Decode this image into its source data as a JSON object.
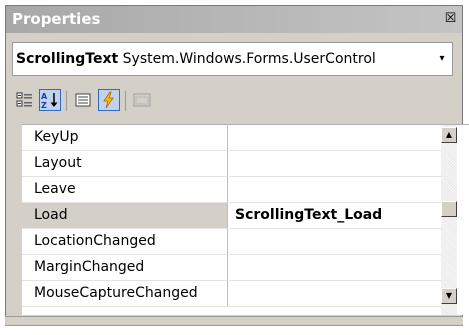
{
  "window": {
    "title": "Properties",
    "close_symbol": "☒"
  },
  "object_selector": {
    "object_name": "ScrollingText",
    "object_type": "System.Windows.Forms.UserControl",
    "dropdown_symbol": "▾"
  },
  "toolbar": {
    "buttons": [
      {
        "icon": "categorized-icon",
        "pressed": false
      },
      {
        "icon": "alphabetical-sort-icon",
        "pressed": true
      },
      {
        "icon": "properties-icon",
        "pressed": false
      },
      {
        "icon": "events-lightning-icon",
        "pressed": true
      },
      {
        "icon": "property-pages-icon",
        "pressed": false
      }
    ]
  },
  "grid": {
    "rows": [
      {
        "name": "KeyUp",
        "value": ""
      },
      {
        "name": "Layout",
        "value": ""
      },
      {
        "name": "Leave",
        "value": ""
      },
      {
        "name": "Load",
        "value": "ScrollingText_Load"
      },
      {
        "name": "LocationChanged",
        "value": ""
      },
      {
        "name": "MarginChanged",
        "value": ""
      },
      {
        "name": "MouseCaptureChanged",
        "value": ""
      }
    ],
    "selected_row": "Load"
  },
  "scrollbar": {
    "up_symbol": "▲",
    "down_symbol": "▼",
    "position_fraction": 0.45
  },
  "colors": {
    "title_bar": "#b4b4b4",
    "pressed_button_border": "#316ac5",
    "pressed_button_fill": "#c1d2ee"
  }
}
